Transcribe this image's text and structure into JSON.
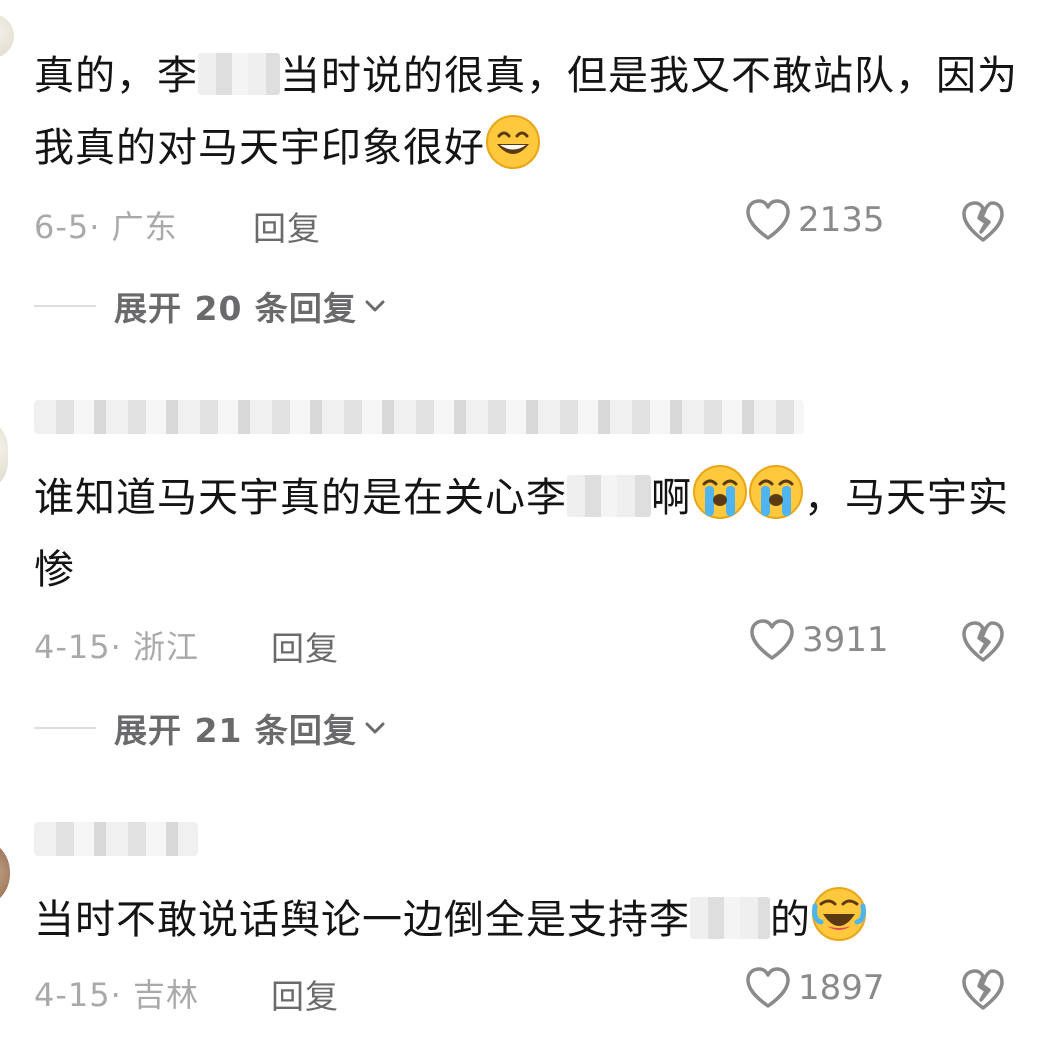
{
  "comments": [
    {
      "text_before": "真的，李",
      "text_after": "当时说的很真，但是我又不敢站队，因为我真的对马天宇印象很好",
      "emoji_icons": [
        "grinning-face-icon"
      ],
      "date": "6-5",
      "location": "广东",
      "reply_label": "回复",
      "likes": "2135",
      "expand_label": "展开 20 条回复"
    },
    {
      "text_before": "谁知道马天宇真的是在关心李",
      "text_middle": "啊",
      "text_after": "，马天宇实惨",
      "emoji_icons": [
        "loudly-crying-face-icon",
        "loudly-crying-face-icon"
      ],
      "date": "4-15",
      "location": "浙江",
      "reply_label": "回复",
      "likes": "3911",
      "expand_label": "展开 21 条回复"
    },
    {
      "text_before": "当时不敢说话舆论一边倒全是支持李",
      "text_after": "的",
      "emoji_icons": [
        "rolling-laughing-face-icon"
      ],
      "date": "4-15",
      "location": "吉林",
      "reply_label": "回复",
      "likes": "1897"
    }
  ],
  "meta_separator": "·",
  "colors": {
    "text": "#141414",
    "meta": "#a9a9ab",
    "reply": "#6b6b6d",
    "emoji_yellow": "#ffc83d"
  }
}
